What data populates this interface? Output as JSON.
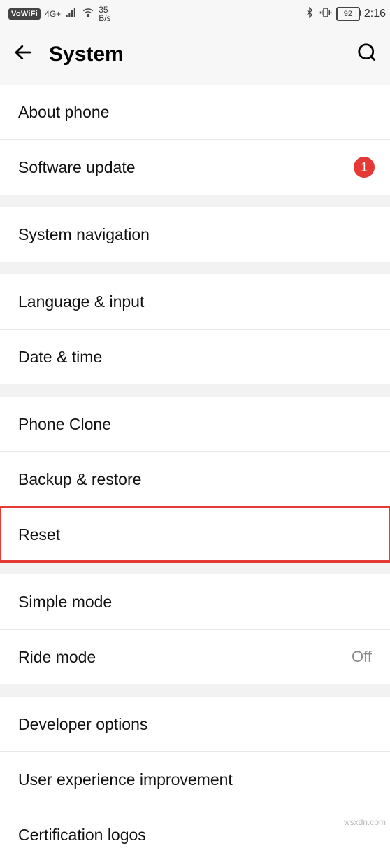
{
  "statusbar": {
    "vowifi": "VoWiFi",
    "net_top": "4G+",
    "net_bottom": "↑↓",
    "speed_top": "35",
    "speed_bottom": "B/s",
    "battery": "92",
    "time": "2:16"
  },
  "header": {
    "title": "System"
  },
  "groups": {
    "g1": {
      "about": "About phone",
      "software_update": "Software update",
      "software_update_badge": "1"
    },
    "g2": {
      "system_navigation": "System navigation"
    },
    "g3": {
      "language_input": "Language & input",
      "date_time": "Date & time"
    },
    "g4": {
      "phone_clone": "Phone Clone",
      "backup_restore": "Backup & restore",
      "reset": "Reset"
    },
    "g5": {
      "simple_mode": "Simple mode",
      "ride_mode": "Ride mode",
      "ride_mode_value": "Off"
    },
    "g6": {
      "developer_options": "Developer options",
      "user_experience": "User experience improvement",
      "certification_logos": "Certification logos"
    }
  },
  "watermark": "wsxdn.com"
}
